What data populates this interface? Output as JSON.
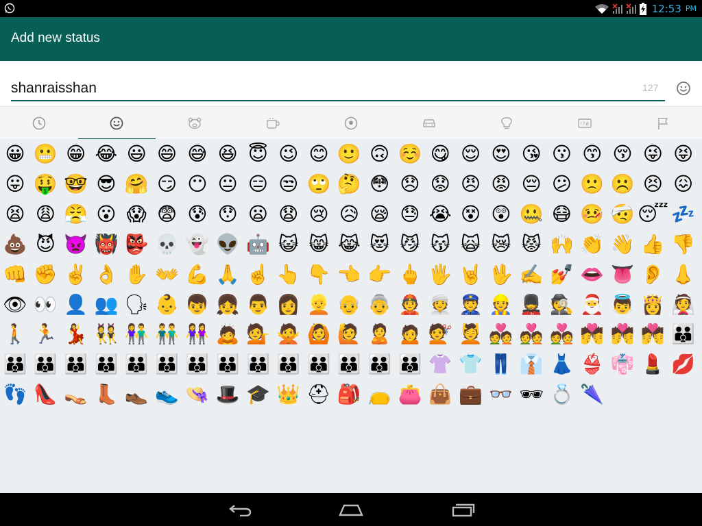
{
  "status_bar": {
    "time": "12:53",
    "ampm": "PM",
    "icons": [
      "whatsapp-icon",
      "wifi-icon",
      "signal-no-service-icon",
      "signal-icon",
      "battery-charging-icon"
    ]
  },
  "app_bar": {
    "title": "Add new status"
  },
  "status_input": {
    "value": "shanraisshan",
    "char_counter": "127",
    "emoji_button_icon": "smiley-icon"
  },
  "emoji_tabs": [
    {
      "icon": "recent-clock-icon",
      "active": false
    },
    {
      "icon": "smiley-face-icon",
      "active": true
    },
    {
      "icon": "animal-bear-icon",
      "active": false
    },
    {
      "icon": "food-cup-icon",
      "active": false
    },
    {
      "icon": "sports-ball-icon",
      "active": false
    },
    {
      "icon": "car-icon",
      "active": false
    },
    {
      "icon": "lightbulb-icon",
      "active": false
    },
    {
      "icon": "symbols-icon",
      "active": false
    },
    {
      "icon": "flag-icon",
      "active": false
    }
  ],
  "emoji_rows": [
    [
      "😀",
      "😬",
      "😁",
      "😂",
      "😃",
      "😄",
      "😅",
      "😆",
      "😇",
      "😉",
      "😊",
      "🙂",
      "🙃",
      "☺️",
      "😋",
      "😌",
      "😍",
      "😘",
      "😗",
      "😙",
      "😚",
      "😜",
      "😝"
    ],
    [
      "😛",
      "🤑",
      "🤓",
      "😎",
      "🤗",
      "😏",
      "😶",
      "😐",
      "😑",
      "😒",
      "🙄",
      "🤔",
      "😳",
      "😞",
      "😟",
      "😠",
      "😡",
      "😔",
      "😕",
      "🙁",
      "☹️",
      "😣",
      "😖"
    ],
    [
      "😫",
      "😩",
      "😤",
      "😮",
      "😱",
      "😨",
      "😰",
      "😯",
      "😦",
      "😧",
      "😢",
      "😥",
      "😪",
      "😓",
      "😭",
      "😵",
      "😲",
      "🤐",
      "😷",
      "🤒",
      "🤕",
      "😴",
      "💤"
    ],
    [
      "💩",
      "😈",
      "👿",
      "👹",
      "👺",
      "💀",
      "👻",
      "👽",
      "🤖",
      "😺",
      "😸",
      "😹",
      "😻",
      "😼",
      "😽",
      "🙀",
      "😿",
      "😾",
      "🙌",
      "👏",
      "👋",
      "👍",
      "👎"
    ],
    [
      "👊",
      "✊",
      "✌️",
      "👌",
      "✋",
      "👐",
      "💪",
      "🙏",
      "☝️",
      "👆",
      "👇",
      "👈",
      "👉",
      "🖕",
      "🖐",
      "🤘",
      "🖖",
      "✍️",
      "💅",
      "👄",
      "👅",
      "👂",
      "👃"
    ],
    [
      "👁",
      "👀",
      "👤",
      "👥",
      "🗣",
      "👶",
      "👦",
      "👧",
      "👨",
      "👩",
      "👱",
      "👴",
      "👵",
      "👲",
      "👳",
      "👮",
      "👷",
      "💂",
      "🕵",
      "🎅",
      "👼",
      "👸",
      "👰"
    ],
    [
      "🚶",
      "🏃",
      "💃",
      "👯",
      "👫",
      "👬",
      "👭",
      "🙇",
      "💁",
      "🙅",
      "🙆",
      "🙋",
      "🙎",
      "🙍",
      "💇",
      "💆",
      "💑",
      "💑",
      "💑",
      "💏",
      "💏",
      "💏",
      "👪"
    ],
    [
      "👪",
      "👪",
      "👪",
      "👪",
      "👪",
      "👪",
      "👪",
      "👪",
      "👪",
      "👪",
      "👪",
      "👪",
      "👪",
      "👪",
      "👚",
      "👕",
      "👖",
      "👔",
      "👗",
      "👙",
      "👘",
      "💄",
      "💋"
    ],
    [
      "👣",
      "👠",
      "👡",
      "👢",
      "👞",
      "👟",
      "👒",
      "🎩",
      "🎓",
      "👑",
      "⛑",
      "🎒",
      "👝",
      "👛",
      "👜",
      "💼",
      "👓",
      "🕶",
      "💍",
      "🌂"
    ]
  ],
  "nav_bar": {
    "buttons": [
      "back-icon",
      "home-icon",
      "recents-icon"
    ]
  }
}
